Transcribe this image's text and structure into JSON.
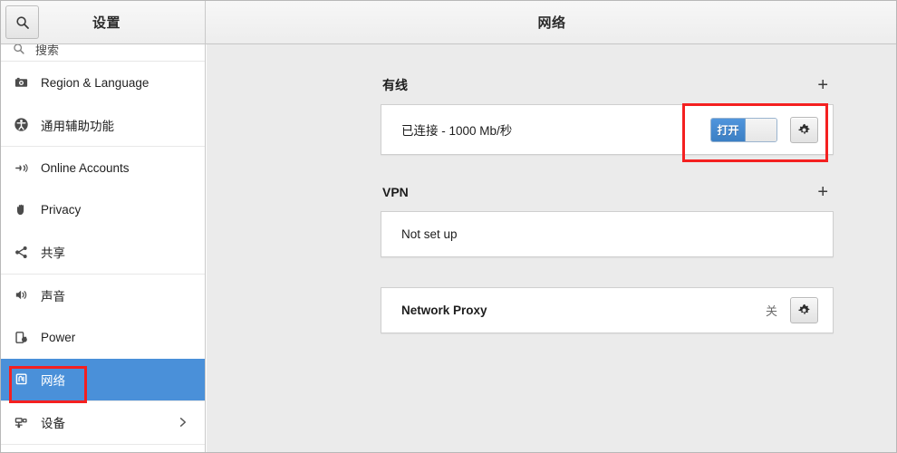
{
  "window": {
    "left_panel_title": "设置",
    "right_panel_title": "网络"
  },
  "sidebar": {
    "search": {
      "placeholder": "搜索",
      "icon": "search-icon"
    },
    "items": [
      {
        "label": "Region & Language",
        "icon": "flag-icon",
        "selected": false,
        "chevron": false
      },
      {
        "label": "通用辅助功能",
        "icon": "accessibility-icon",
        "selected": false,
        "chevron": false
      },
      {
        "label": "Online Accounts",
        "icon": "plug-icon",
        "selected": false,
        "chevron": false
      },
      {
        "label": "Privacy",
        "icon": "hand-icon",
        "selected": false,
        "chevron": false
      },
      {
        "label": "共享",
        "icon": "share-icon",
        "selected": false,
        "chevron": false
      },
      {
        "label": "声音",
        "icon": "speaker-icon",
        "selected": false,
        "chevron": false
      },
      {
        "label": "Power",
        "icon": "battery-icon",
        "selected": false,
        "chevron": false
      },
      {
        "label": "网络",
        "icon": "network-icon",
        "selected": true,
        "chevron": false
      },
      {
        "label": "设备",
        "icon": "devices-icon",
        "selected": false,
        "chevron": true
      }
    ]
  },
  "main": {
    "wired": {
      "title": "有线",
      "add_label": "+",
      "status": "已连接 - 1000 Mb/秒",
      "toggle_label": "打开",
      "toggle_state": "on",
      "settings_icon": "gear-icon"
    },
    "vpn": {
      "title": "VPN",
      "add_label": "+",
      "status": "Not set up"
    },
    "proxy": {
      "title": "Network Proxy",
      "status": "关",
      "settings_icon": "gear-icon"
    }
  },
  "colors": {
    "accent_blue": "#4a90d9",
    "toggle_blue": "#3b7fc4",
    "annotation_red": "#f42020",
    "content_bg": "#ebebeb"
  }
}
